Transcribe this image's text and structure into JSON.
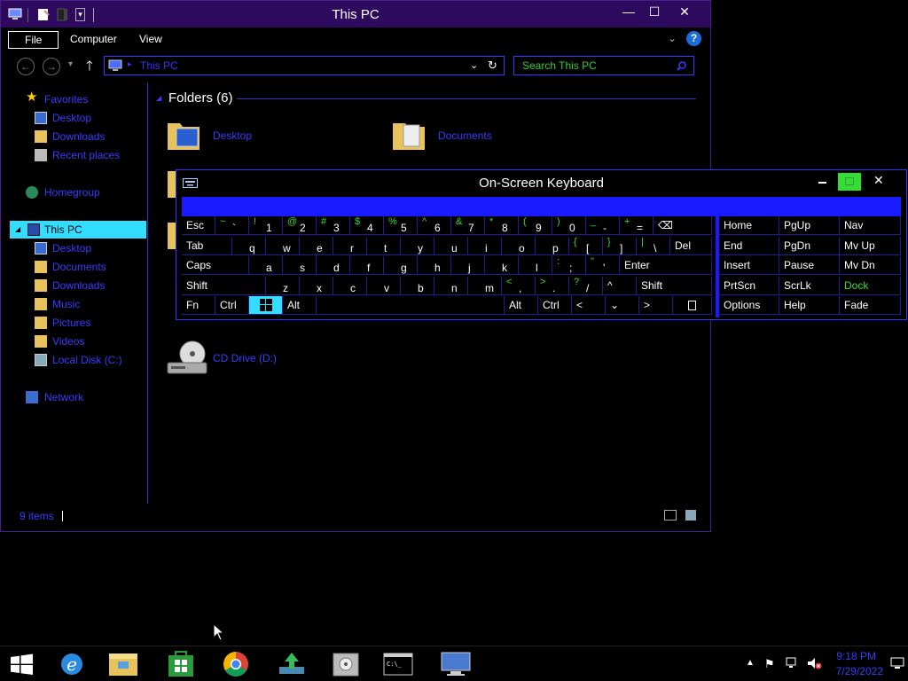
{
  "window": {
    "title": "This PC",
    "minimize": "—",
    "maximize": "☐",
    "close": "✕"
  },
  "ribbon": {
    "tabs": [
      "File",
      "Computer",
      "View"
    ]
  },
  "address": {
    "path": "This PC",
    "search_placeholder": "Search This PC"
  },
  "nav": {
    "favorites": "Favorites",
    "desktop": "Desktop",
    "downloads": "Downloads",
    "recent": "Recent places",
    "homegroup": "Homegroup",
    "this_pc": "This PC",
    "pc_items": [
      "Desktop",
      "Documents",
      "Downloads",
      "Music",
      "Pictures",
      "Videos",
      "Local Disk (C:)"
    ],
    "network": "Network"
  },
  "files": {
    "group_title": "Folders (6)",
    "desktop": "Desktop",
    "documents": "Documents",
    "cd_drive": "CD Drive (D:)"
  },
  "status": {
    "items": "9 items"
  },
  "osk": {
    "title": "On-Screen Keyboard",
    "row1": [
      {
        "k": "Esc"
      },
      {
        "s": "~",
        "m": "`"
      },
      {
        "s": "!",
        "m": "1"
      },
      {
        "s": "@",
        "m": "2"
      },
      {
        "s": "#",
        "m": "3"
      },
      {
        "s": "$",
        "m": "4"
      },
      {
        "s": "%",
        "m": "5"
      },
      {
        "s": "^",
        "m": "6"
      },
      {
        "s": "&",
        "m": "7"
      },
      {
        "s": "*",
        "m": "8"
      },
      {
        "s": "(",
        "m": "9"
      },
      {
        "s": ")",
        "m": "0"
      },
      {
        "s": "_",
        "m": "-"
      },
      {
        "s": "+",
        "m": "="
      }
    ],
    "backspace": "⌫",
    "row2": [
      "Tab",
      "q",
      "w",
      "e",
      "r",
      "t",
      "y",
      "u",
      "i",
      "o",
      "p"
    ],
    "row2_brackets": [
      {
        "s": "{",
        "m": "["
      },
      {
        "s": "}",
        "m": "]"
      },
      {
        "s": "|",
        "m": "\\"
      }
    ],
    "del": "Del",
    "row3": [
      "Caps",
      "a",
      "s",
      "d",
      "f",
      "g",
      "h",
      "j",
      "k",
      "l"
    ],
    "row3_punct": [
      {
        "s": ":",
        "m": ";"
      },
      {
        "s": "\"",
        "m": "'"
      }
    ],
    "enter": "Enter",
    "row4": [
      "Shift",
      "z",
      "x",
      "c",
      "v",
      "b",
      "n",
      "m"
    ],
    "row4_punct": [
      {
        "s": "<",
        "m": ","
      },
      {
        "s": ">",
        "m": "."
      },
      {
        "s": "?",
        "m": "/"
      }
    ],
    "up": "^",
    "shift_r": "Shift",
    "row5": {
      "fn": "Fn",
      "ctrl": "Ctrl",
      "alt": "Alt",
      "alt_r": "Alt",
      "ctrl_r": "Ctrl",
      "left": "<",
      "down": "⌄",
      "right": ">"
    },
    "nav_keys": [
      [
        "Home",
        "PgUp",
        "Nav"
      ],
      [
        "End",
        "PgDn",
        "Mv Up"
      ],
      [
        "Insert",
        "Pause",
        "Mv Dn"
      ],
      [
        "PrtScn",
        "ScrLk",
        "Dock"
      ],
      [
        "Options",
        "Help",
        "Fade"
      ]
    ]
  },
  "tray": {
    "time": "9:18 PM",
    "date": "7/29/2022"
  },
  "colors": {
    "title_bg": "#2d0a5e",
    "accent_blue": "#3a3aff",
    "cyan": "#33ddff",
    "green": "#33dd33"
  }
}
